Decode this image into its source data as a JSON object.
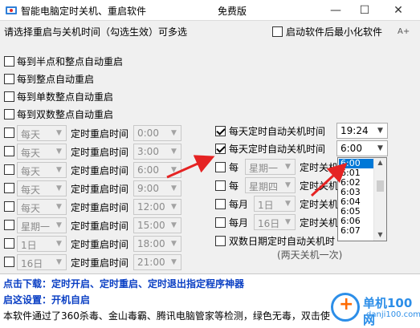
{
  "window": {
    "title": "智能电脑定时关机、重启软件",
    "badge": "免费版",
    "minimize_glyph": "—",
    "maximize_glyph": "☐",
    "close_glyph": "✕"
  },
  "header": {
    "instruction": "请选择重启与关机时间（勾选生效）可多选",
    "start_minimized_label": "启动软件后最小化软件",
    "font_button": "A+"
  },
  "restart_options": [
    {
      "label": "每到半点和整点自动重启",
      "checked": false
    },
    {
      "label": "每到整点自动重启",
      "checked": false
    },
    {
      "label": "每到单数整点自动重启",
      "checked": false
    },
    {
      "label": "每到双数整点自动重启",
      "checked": false
    }
  ],
  "timed_restart": {
    "label": "定时重启时间",
    "rows": [
      {
        "period": "每天",
        "time": "0:00"
      },
      {
        "period": "每天",
        "time": "3:00"
      },
      {
        "period": "每天",
        "time": "6:00"
      },
      {
        "period": "每天",
        "time": "9:00"
      },
      {
        "period": "每天",
        "time": "12:00"
      },
      {
        "period": "星期一",
        "time": "15:00"
      },
      {
        "period": "1日",
        "time": "18:00"
      },
      {
        "period": "16日",
        "time": "21:00"
      }
    ]
  },
  "shutdown": {
    "row1": {
      "label": "每天定时自动关机时间",
      "time": "19:24",
      "checked": true
    },
    "row2": {
      "label": "每天定时自动关机时间",
      "time": "6:00",
      "checked": true
    },
    "row3": {
      "prefix": "每",
      "period": "星期一",
      "label": "定时关机"
    },
    "row4": {
      "prefix": "每",
      "period": "星期四",
      "label": "定时关机"
    },
    "row5": {
      "prefix": "每月",
      "period": "1日",
      "label": "定时关机"
    },
    "row6": {
      "prefix": "每月",
      "period": "16日",
      "label": "定时关机"
    },
    "row7": {
      "label": "双数日期定时自动关机时"
    },
    "note": "(两天关机一次)"
  },
  "dropdown": {
    "options": [
      "6:00",
      "6:01",
      "6:02",
      "6:03",
      "6:04",
      "6:05",
      "6:06",
      "6:07"
    ],
    "selected": "6:00"
  },
  "footer": {
    "download_text": "点击下载：定时开启、定时重启、定时退出指定程序神器",
    "settings_text": "启这设置：开机自启",
    "description": "本软件通过了360杀毒、金山毒霸、腾讯电脑管家等检测，绿色无毒，双击使"
  },
  "watermark": {
    "plus_glyph": "+",
    "site_name": "单机100网",
    "site_url": "danji100.com"
  },
  "colors": {
    "accent": "#0078d7",
    "link_blue": "#0a3fc4",
    "arrow_red": "#e52323"
  }
}
